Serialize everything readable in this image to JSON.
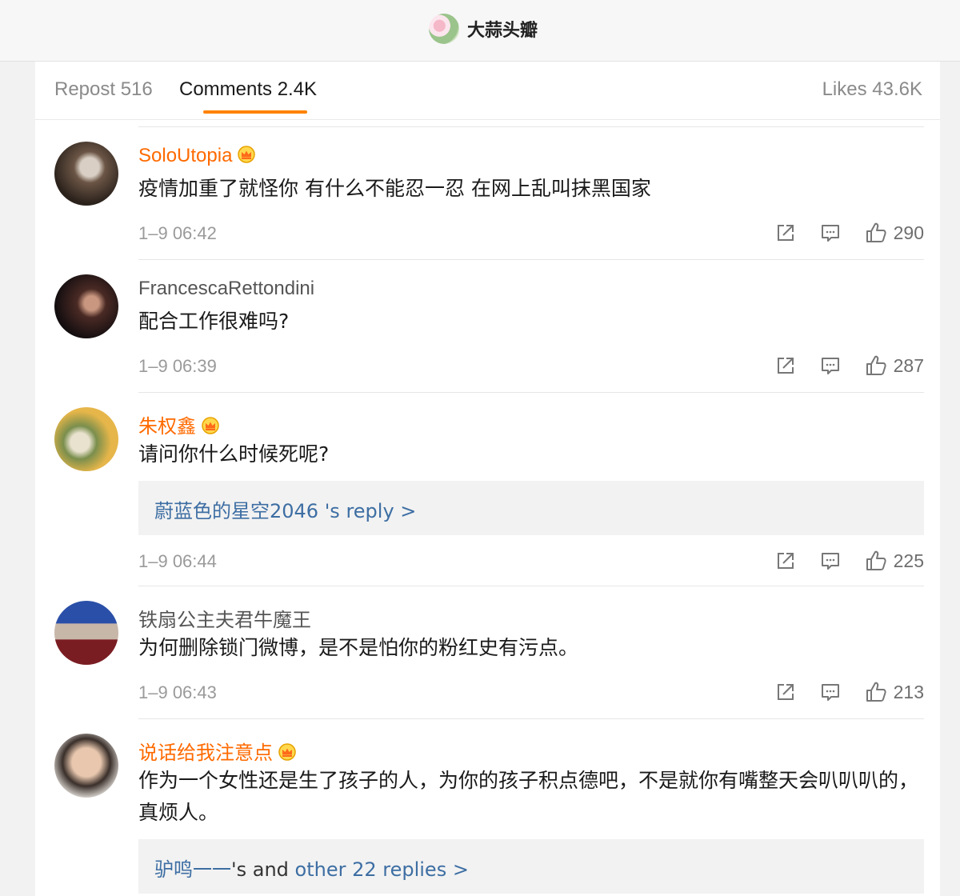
{
  "header": {
    "user_name": "大蒜头瓣"
  },
  "tabs": {
    "repost": "Repost 516",
    "comments": "Comments 2.4K",
    "likes": "Likes 43.6K"
  },
  "comments": [
    {
      "name": "SoloUtopia",
      "text": "疫情加重了就怪你 有什么不能忍一忍 在网上乱叫抹黑国家",
      "time": "1–9 06:42",
      "likes": "290"
    },
    {
      "name": "FrancescaRettondini",
      "text": "配合工作很难吗?",
      "time": "1–9 06:39",
      "likes": "287"
    },
    {
      "name": "朱权鑫",
      "text": "请问你什么时候死呢?",
      "reply_user": "蔚蓝色的星空2046",
      "reply_suffix": " 's reply >",
      "time": "1–9 06:44",
      "likes": "225"
    },
    {
      "name": "铁扇公主夫君牛魔王",
      "text": "为何删除锁门微博，是不是怕你的粉红史有污点。",
      "time": "1–9 06:43",
      "likes": "213"
    },
    {
      "name": "说话给我注意点",
      "text": "作为一个女性还是生了孩子的人，为你的孩子积点德吧，不是就你有嘴整天会叭叭叭的，真烦人。",
      "reply_user": "驴鸣一一",
      "reply_mid": "'s and ",
      "reply_more": "other 22 replies >"
    }
  ],
  "icons": [
    "share-icon",
    "comment-icon",
    "like-icon",
    "crown-icon"
  ],
  "colors": {
    "accent": "#ff8200",
    "vip_name": "#ff6a00",
    "link": "#3d6ea3"
  }
}
